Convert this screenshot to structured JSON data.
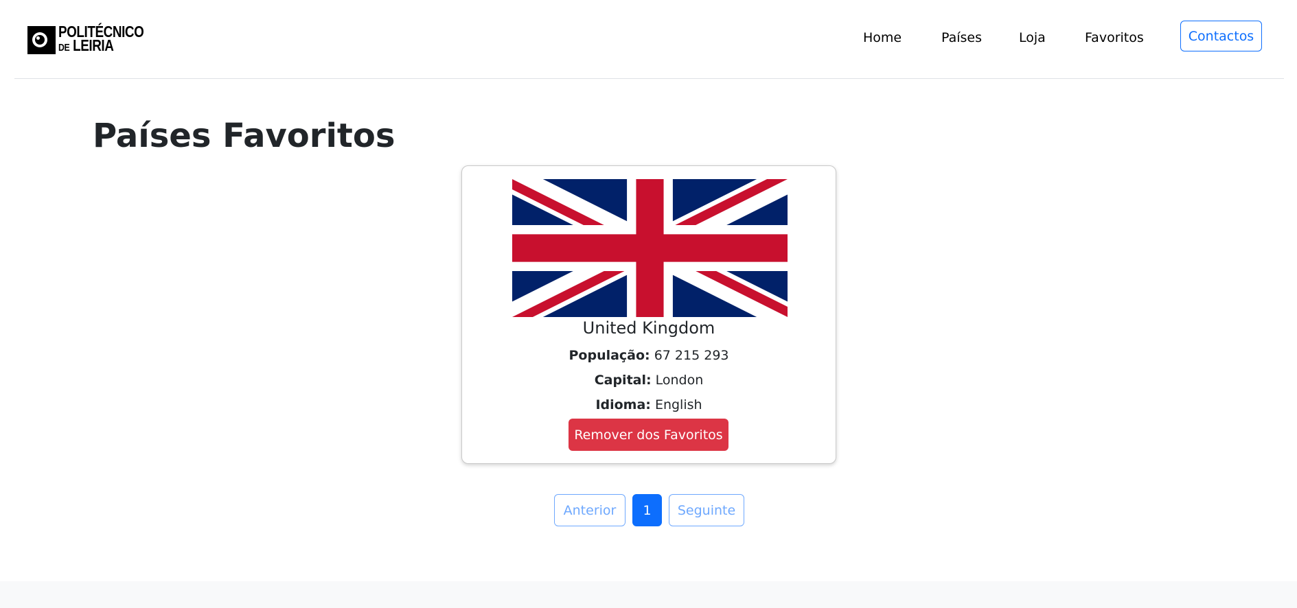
{
  "logo": {
    "line1": "POLITÉCNICO",
    "line2_prefix": "DE",
    "line2": "LEIRIA"
  },
  "nav": {
    "items": [
      {
        "label": "Home"
      },
      {
        "label": "Países"
      },
      {
        "label": "Loja"
      },
      {
        "label": "Favoritos"
      }
    ],
    "contact_label": "Contactos",
    "contact_color": "#0d6efd"
  },
  "page": {
    "title": "Países Favoritos"
  },
  "card": {
    "flag_icon": "uk-flag-icon",
    "country_name": "United Kingdom",
    "population_label": "População:",
    "population_value": "67 215 293",
    "capital_label": "Capital:",
    "capital_value": "London",
    "language_label": "Idioma:",
    "language_value": "English",
    "remove_label": "Remover dos Favoritos",
    "remove_color": "#dc3545"
  },
  "pagination": {
    "prev_label": "Anterior",
    "current_page": "1",
    "next_label": "Seguinte",
    "active_color": "#0d6efd"
  }
}
